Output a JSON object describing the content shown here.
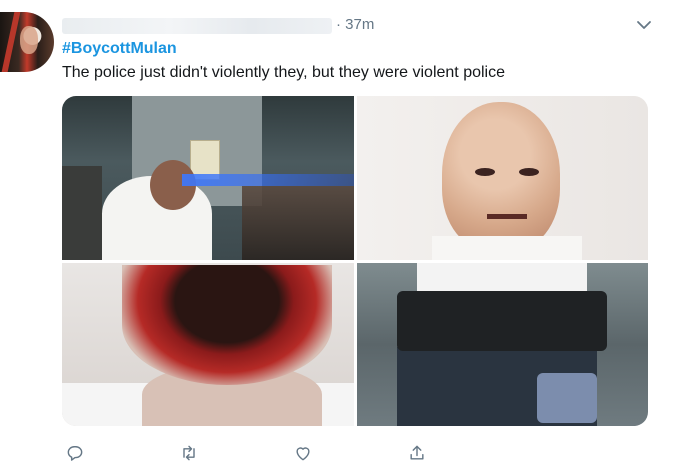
{
  "tweet": {
    "timestamp": "· 37m",
    "hashtag": "#BoycottMulan",
    "text": "The police just didn't violently they, but they were violent police"
  },
  "icons": {
    "more": "chevron-down-icon",
    "reply": "reply-icon",
    "retweet": "retweet-icon",
    "like": "like-icon",
    "share": "share-icon"
  },
  "colors": {
    "hashtag": "#1b95e0",
    "text": "#14171a",
    "muted": "#657786"
  }
}
